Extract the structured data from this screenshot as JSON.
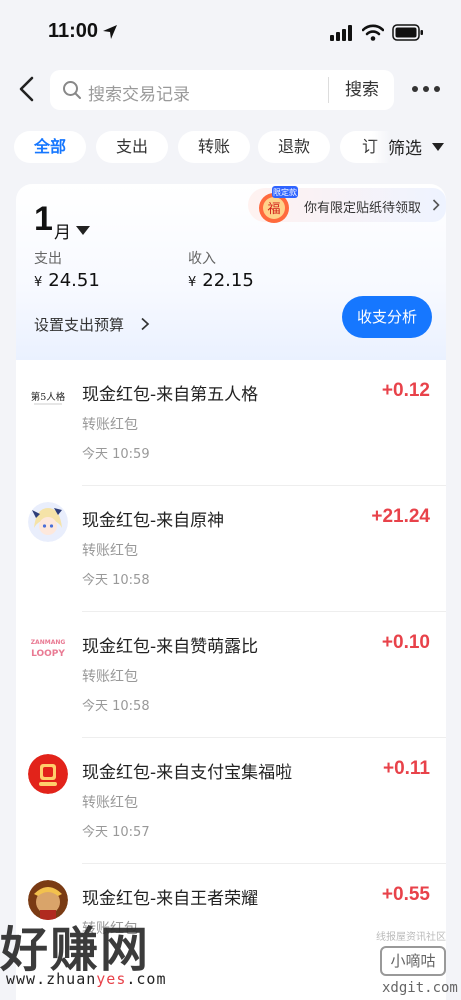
{
  "status_bar": {
    "time": "11:00"
  },
  "search": {
    "placeholder": "搜索交易记录",
    "button": "搜索"
  },
  "filters": {
    "chips": [
      "全部",
      "支出",
      "转账",
      "退款",
      "订"
    ],
    "filter_label": "筛选"
  },
  "summary": {
    "month_number": "1",
    "month_unit": "月",
    "promo_badge_top": "限定款",
    "promo_badge_char": "福",
    "promo_text": "你有限定贴纸待领取",
    "expense_label": "支出",
    "expense_value": "24.51",
    "income_label": "收入",
    "income_value": "22.15",
    "currency": "¥",
    "budget_label": "设置支出预算",
    "analysis_button": "收支分析"
  },
  "transactions": [
    {
      "title": "现金红包-来自第五人格",
      "subtitle": "转账红包",
      "time": "今天 10:59",
      "amount": "+0.12",
      "avatar_text": "第5人格",
      "avatar_icon": "identity-v-logo"
    },
    {
      "title": "现金红包-来自原神",
      "subtitle": "转账红包",
      "time": "今天 10:58",
      "amount": "+21.24",
      "avatar_icon": "genshin-character-avatar"
    },
    {
      "title": "现金红包-来自赞萌露比",
      "subtitle": "转账红包",
      "time": "今天 10:58",
      "amount": "+0.10",
      "avatar_text_top": "ZANMANG",
      "avatar_text_bottom": "LOOPY",
      "avatar_icon": "loopy-logo"
    },
    {
      "title": "现金红包-来自支付宝集福啦",
      "subtitle": "转账红包",
      "time": "今天 10:57",
      "amount": "+0.11",
      "avatar_icon": "alipay-jifu-logo"
    },
    {
      "title": "现金红包-来自王者荣耀",
      "subtitle": "转账红包",
      "time": "",
      "amount": "+0.55",
      "avatar_icon": "honor-of-kings-avatar"
    }
  ],
  "watermarks": {
    "left_big": "好赚网",
    "left_url_a": "www.zhuan",
    "left_url_b": "yes",
    "left_url_c": ".com",
    "right_small": "线报屋资讯社区",
    "right_tag": "小嘀咕",
    "right_site": "xdgit.com"
  },
  "colors": {
    "accent": "#1677ff",
    "income_red": "#e8424a"
  }
}
